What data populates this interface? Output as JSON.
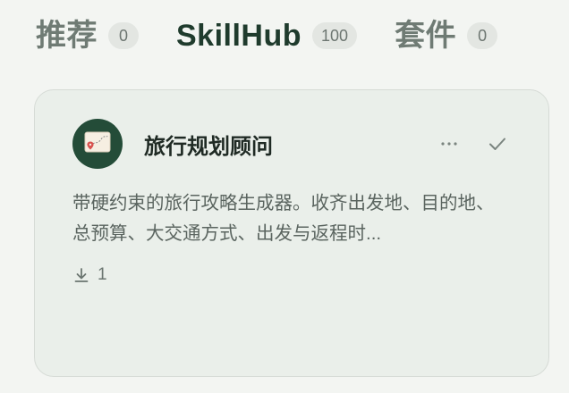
{
  "tabs": [
    {
      "label": "推荐",
      "count": "0",
      "active": false
    },
    {
      "label": "SkillHub",
      "count": "100",
      "active": true
    },
    {
      "label": "套件",
      "count": "0",
      "active": false
    }
  ],
  "card": {
    "icon": "travel-map-icon",
    "title": "旅行规划顾问",
    "description": "带硬约束的旅行攻略生成器。收齐出发地、目的地、总预算、大交通方式、出发与返程时...",
    "download_icon": "download-icon",
    "downloads": "1",
    "more_icon": "more-horizontal-icon",
    "check_icon": "check-icon"
  },
  "colors": {
    "background": "#f3f5f2",
    "card_background": "#eaefea",
    "avatar": "#244c38",
    "active_tab": "#1f3b2d",
    "inactive_tab": "#6f7b74"
  }
}
